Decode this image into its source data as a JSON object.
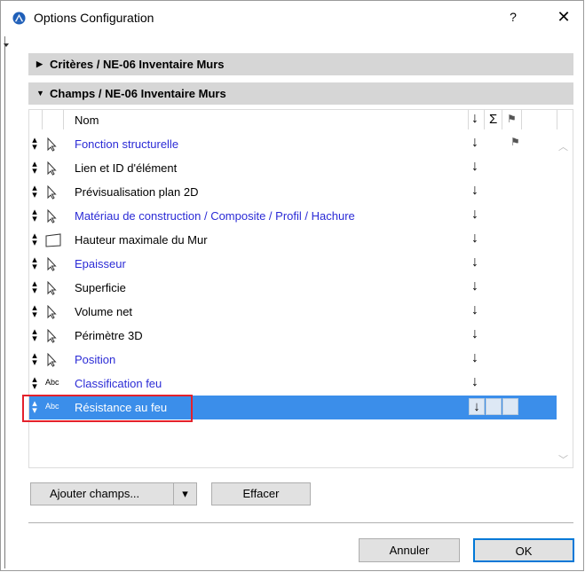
{
  "window": {
    "title": "Options Configuration",
    "help_label": "?",
    "close_label": "✕"
  },
  "sections": {
    "criteria": {
      "label": "Critères / NE-06 Inventaire Murs",
      "expander": "▶"
    },
    "fields": {
      "label": "Champs / NE-06 Inventaire Murs",
      "expander": "▼"
    }
  },
  "table": {
    "header": {
      "name": "Nom",
      "sort_icon": "↓",
      "sum_icon": "Σ",
      "flag_icon": "⚑"
    },
    "rows": [
      {
        "label": "Fonction structurelle",
        "icon": "arrow-cursor-icon",
        "highlight": true,
        "sort": "↓",
        "flag": "⚑"
      },
      {
        "label": "Lien et ID d'élément",
        "icon": "arrow-cursor-icon",
        "highlight": false,
        "sort": "↓",
        "flag": ""
      },
      {
        "label": "Prévisualisation plan 2D",
        "icon": "arrow-cursor-icon",
        "highlight": false,
        "sort": "↓",
        "flag": ""
      },
      {
        "label": "Matériau de construction / Composite / Profil / Hachure",
        "icon": "arrow-cursor-icon",
        "highlight": true,
        "sort": "↓",
        "flag": ""
      },
      {
        "label": "Hauteur maximale du Mur",
        "icon": "rectangle-icon",
        "highlight": false,
        "sort": "↓",
        "flag": ""
      },
      {
        "label": "Epaisseur",
        "icon": "arrow-cursor-icon",
        "highlight": true,
        "sort": "↓",
        "flag": ""
      },
      {
        "label": "Superficie",
        "icon": "arrow-cursor-icon",
        "highlight": false,
        "sort": "↓",
        "flag": ""
      },
      {
        "label": "Volume net",
        "icon": "arrow-cursor-icon",
        "highlight": false,
        "sort": "↓",
        "flag": ""
      },
      {
        "label": "Périmètre 3D",
        "icon": "arrow-cursor-icon",
        "highlight": false,
        "sort": "↓",
        "flag": ""
      },
      {
        "label": "Position",
        "icon": "arrow-cursor-icon",
        "highlight": true,
        "sort": "↓",
        "flag": ""
      },
      {
        "label": "Classification feu",
        "icon": "abc-icon",
        "icon_text": "Abc",
        "highlight": true,
        "sort": "↓",
        "flag": ""
      },
      {
        "label": "Résistance au feu",
        "icon": "abc-icon",
        "icon_text": "Abc",
        "highlight": false,
        "selected": true,
        "sort": "↓",
        "flag": ""
      }
    ]
  },
  "buttons": {
    "add_fields": "Ajouter champs...",
    "add_fields_dropdown": "▾",
    "clear": "Effacer",
    "cancel": "Annuler",
    "ok": "OK"
  },
  "colors": {
    "link_blue": "#2b2bd6",
    "selection": "#3b8eea",
    "annotation_red": "#e4212b"
  }
}
